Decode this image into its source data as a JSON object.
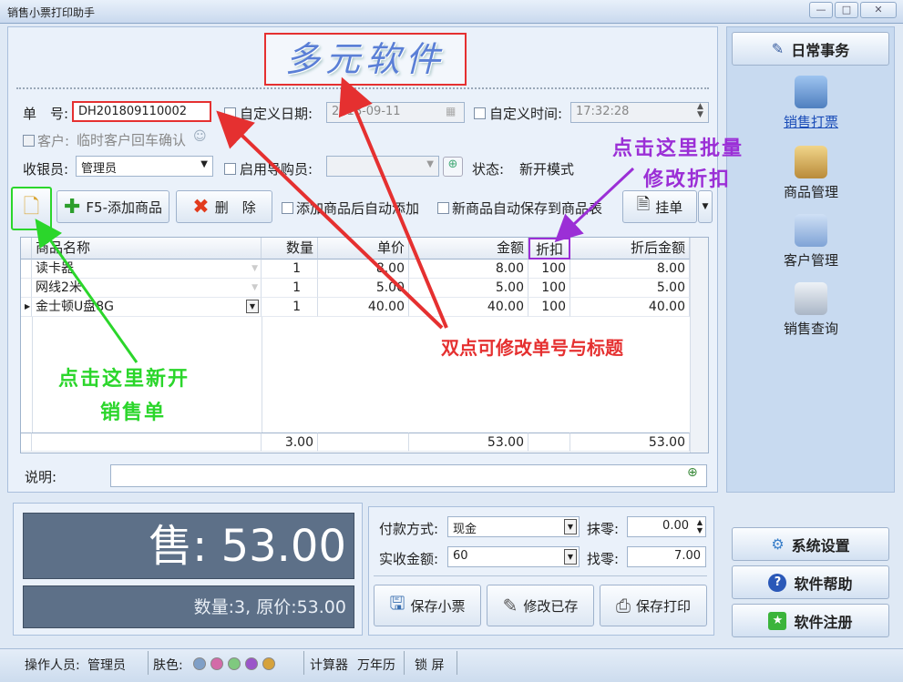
{
  "window": {
    "title": "销售小票打印助手",
    "min": "—",
    "max": "□",
    "close": "✕"
  },
  "logo": {
    "text": "多元软件"
  },
  "form": {
    "order_no_label": "单　号:",
    "order_no_value": "DH201809110002",
    "custom_date_label": "自定义日期:",
    "custom_date_value": "2018-09-11",
    "custom_time_label": "自定义时间:",
    "custom_time_value": "17:32:28",
    "customer_label": "客户:",
    "customer_value": "临时客户回车确认",
    "cashier_label": "收银员:",
    "cashier_value": "管理员",
    "guide_label": "启用导购员:",
    "guide_value": "",
    "status_label": "状态:",
    "status_value": "新开模式"
  },
  "toolbar": {
    "add_product": "F5-添加商品",
    "delete": "删　除",
    "auto_add": "添加商品后自动添加",
    "auto_save": "新商品自动保存到商品表",
    "hold": "挂单"
  },
  "table": {
    "headers": [
      "商品名称",
      "数量",
      "单价",
      "金额",
      "折扣",
      "折后金额"
    ],
    "rows": [
      {
        "name": "读卡器",
        "qty": "1",
        "price": "8.00",
        "amount": "8.00",
        "discount": "100",
        "final": "8.00"
      },
      {
        "name": "网线2米",
        "qty": "1",
        "price": "5.00",
        "amount": "5.00",
        "discount": "100",
        "final": "5.00"
      },
      {
        "name": "金士顿U盘8G",
        "qty": "1",
        "price": "40.00",
        "amount": "40.00",
        "discount": "100",
        "final": "40.00"
      }
    ],
    "totals": {
      "qty": "3.00",
      "amount": "53.00",
      "final": "53.00"
    }
  },
  "note": {
    "label": "说明:",
    "value": ""
  },
  "summary": {
    "sale": "售: 53.00",
    "detail": "数量:3, 原价:53.00"
  },
  "payment": {
    "method_label": "付款方式:",
    "method_value": "现金",
    "rounding_label": "抹零:",
    "rounding_value": "0.00",
    "received_label": "实收金额:",
    "received_value": "60",
    "change_label": "找零:",
    "change_value": "7.00"
  },
  "actions": {
    "save": "保存小票",
    "modify": "修改已存",
    "save_print": "保存打印"
  },
  "nav": {
    "header": "日常事务",
    "items": [
      "销售打票",
      "商品管理",
      "客户管理",
      "销售查询"
    ],
    "settings": "系统设置",
    "help": "软件帮助",
    "register": "软件注册"
  },
  "annotations": {
    "red": "双点可修改单号与标题",
    "purple_line1": "点击这里批量",
    "purple_line2": "修改折扣",
    "green_line1": "点击这里新开",
    "green_line2": "销售单"
  },
  "statusbar": {
    "operator_label": "操作人员:",
    "operator_value": "管理员",
    "skin_label": "肤色:",
    "calculator": "计算器",
    "calendar": "万年历",
    "lock": "锁 屏"
  },
  "colors": {
    "red": "#e53030",
    "purple": "#9b2fd6",
    "green": "#2bd62b",
    "skins": [
      "#7f9fc7",
      "#d36aa8",
      "#7fc97f",
      "#9b55c9",
      "#d6a23c"
    ]
  }
}
